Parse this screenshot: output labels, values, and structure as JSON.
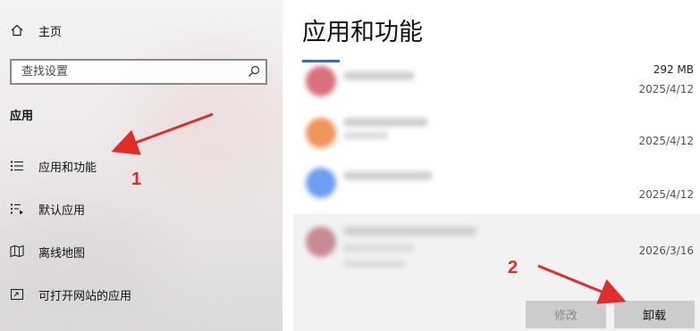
{
  "nav": {
    "home_label": "主页",
    "search_placeholder": "查找设置",
    "section_heading": "应用",
    "items": [
      {
        "label": "应用和功能",
        "icon": "apps-features-icon"
      },
      {
        "label": "默认应用",
        "icon": "default-apps-icon"
      },
      {
        "label": "离线地图",
        "icon": "offline-maps-icon"
      },
      {
        "label": "可打开网站的应用",
        "icon": "apps-for-websites-icon"
      }
    ]
  },
  "main": {
    "title": "应用和功能",
    "apps": [
      {
        "size": "292 MB",
        "date": "2025/4/12",
        "icon_color": "#d9707e"
      },
      {
        "size": "",
        "date": "2025/4/12",
        "icon_color": "#f0955c"
      },
      {
        "size": "",
        "date": "2025/4/12",
        "icon_color": "#6f9ef0"
      },
      {
        "size": "",
        "date": "2026/3/16",
        "icon_color": "#c98b93"
      }
    ],
    "modify_label": "修改",
    "uninstall_label": "卸载"
  },
  "annotations": {
    "step1": "1",
    "step2": "2",
    "arrow_color": "#e22b2b"
  }
}
